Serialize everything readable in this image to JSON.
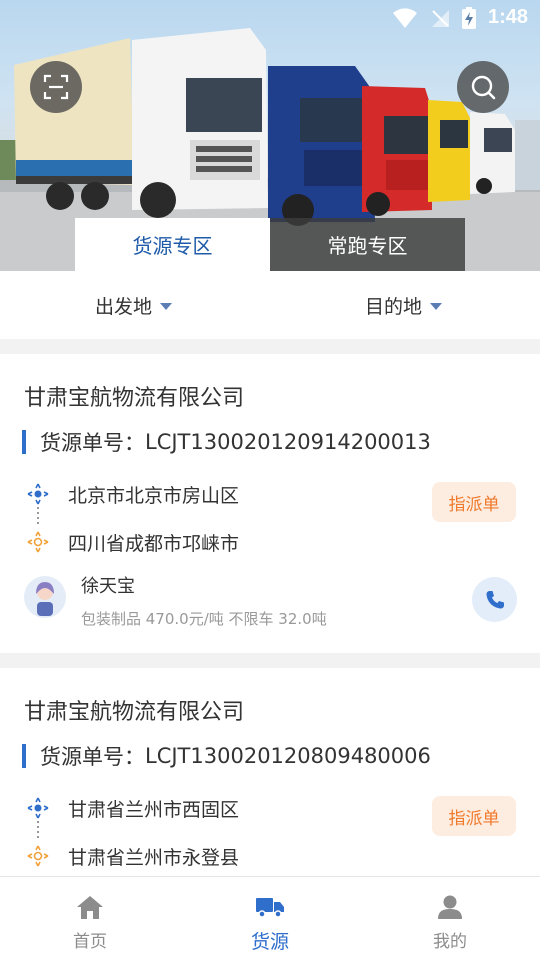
{
  "status_bar": {
    "time": "1:48"
  },
  "header": {
    "tabs": [
      {
        "label": "货源专区",
        "active": true
      },
      {
        "label": "常跑专区",
        "active": false
      }
    ]
  },
  "filters": {
    "origin_label": "出发地",
    "destination_label": "目的地"
  },
  "cards": [
    {
      "company": "甘肃宝航物流有限公司",
      "order_label": "货源单号：",
      "order_no": "LCJT13002012091420001​3",
      "from": "北京市北京市房山区",
      "to": "四川省成都市邛崃市",
      "badge": "指派单",
      "contact_name": "徐天宝",
      "cargo_detail": "包装制品 470.0元/吨 不限车 32.0吨"
    },
    {
      "company": "甘肃宝航物流有限公司",
      "order_label": "货源单号：",
      "order_no": "LCJT130020120809480006",
      "from": "甘肃省兰州市西固区",
      "to": "甘肃省兰州市永登县",
      "badge": "指派单"
    }
  ],
  "bottom_nav": [
    {
      "label": "首页",
      "icon": "home-icon",
      "active": false
    },
    {
      "label": "货源",
      "icon": "truck-icon",
      "active": true
    },
    {
      "label": "我的",
      "icon": "person-icon",
      "active": false
    }
  ],
  "colors": {
    "accent": "#2f6ecb",
    "badge_bg": "#fdece0",
    "badge_text": "#f07a2c"
  }
}
